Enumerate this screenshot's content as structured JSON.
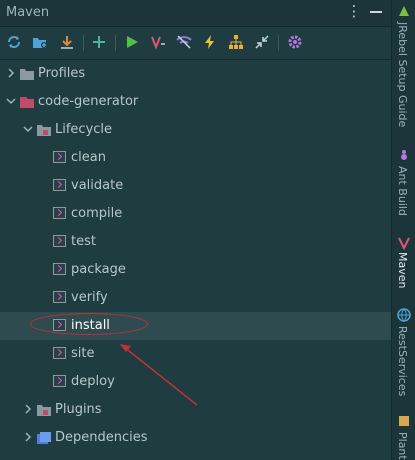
{
  "window": {
    "title": "Maven"
  },
  "toolbar": {
    "icons": [
      "reload-icon",
      "add-folder-icon",
      "download-icon",
      "plus-icon",
      "run-icon",
      "maven-goal-icon",
      "toggle-offline-icon",
      "lightning-icon",
      "dependency-graph-icon",
      "collapse-icon",
      "settings-icon"
    ]
  },
  "tree": {
    "profiles": "Profiles",
    "project": "code-generator",
    "lifecycle": "Lifecycle",
    "goals": [
      "clean",
      "validate",
      "compile",
      "test",
      "package",
      "verify",
      "install",
      "site",
      "deploy"
    ],
    "plugins": "Plugins",
    "dependencies": "Dependencies"
  },
  "sidebar": {
    "tabs": [
      {
        "label": "JRebel Setup Guide"
      },
      {
        "label": "Ant Build"
      },
      {
        "label": "Maven"
      },
      {
        "label": "RestServices"
      },
      {
        "label": "Plant"
      }
    ]
  },
  "colors": {
    "accent": "#d05fb3",
    "selection": "#2e4b50",
    "annotation": "#c0323a"
  }
}
